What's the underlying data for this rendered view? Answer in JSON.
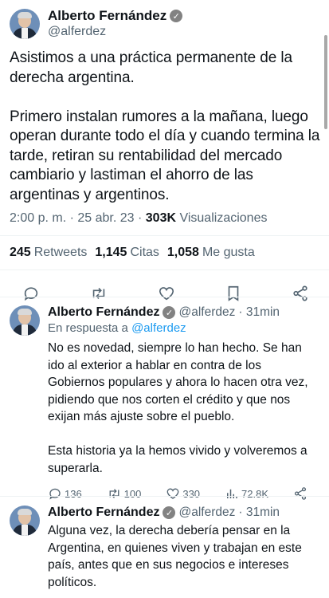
{
  "main_tweet": {
    "author_name": "Alberto Fernández",
    "handle": "@alferdez",
    "text": "Asistimos a una práctica permanente de la derecha argentina.\n\nPrimero instalan rumores a la mañana, luego operan durante todo el día y cuando termina la tarde, retiran su rentabilidad del mercado cambiario y lastiman el ahorro de las argentinas y argentinos.",
    "time": "2:00 p. m. · 25 abr. 23 ·",
    "views_count": "303K",
    "views_label": "Visualizaciones",
    "retweets_count": "245",
    "retweets_label": "Retweets",
    "quotes_count": "1,145",
    "quotes_label": "Citas",
    "likes_count": "1,058",
    "likes_label": "Me gusta"
  },
  "replies": [
    {
      "author_name": "Alberto Fernández",
      "handle": "@alferdez",
      "time": "· 31min",
      "in_reply_prefix": "En respuesta a",
      "in_reply_handle": "@alferdez",
      "text": "No es novedad, siempre lo han hecho. Se han ido al exterior a hablar en contra de los Gobiernos populares y ahora lo hacen otra vez, pidiendo que nos corten el crédito y que nos exijan más ajuste sobre el pueblo.\n\nEsta historia ya la hemos vivido y volveremos a superarla.",
      "reply_count": "136",
      "retweet_count": "100",
      "like_count": "330",
      "view_count": "72.8K"
    },
    {
      "author_name": "Alberto Fernández",
      "handle": "@alferdez",
      "time": "· 31min",
      "text": "Alguna vez, la derecha debería pensar en la Argentina, en quienes viven y trabajan en este país, antes que en sus negocios e intereses políticos."
    }
  ],
  "icons": [
    "verified-badge-icon",
    "reply-icon",
    "retweet-icon",
    "like-icon",
    "bookmark-icon",
    "share-icon",
    "views-icon"
  ]
}
